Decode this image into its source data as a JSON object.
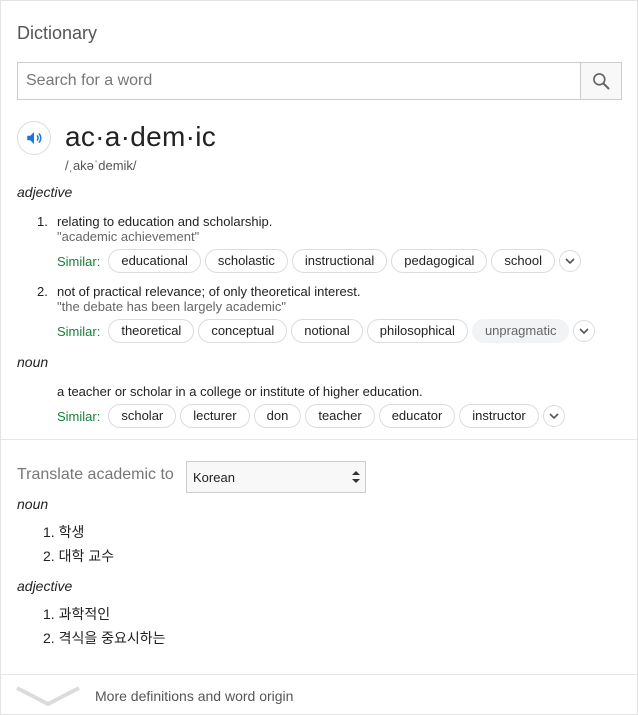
{
  "title": "Dictionary",
  "search": {
    "placeholder": "Search for a word",
    "value": ""
  },
  "entry": {
    "headword": "ac·a·dem·ic",
    "phonetic": "/ˌakəˈdemik/",
    "senses": [
      {
        "pos": "adjective",
        "definitions": [
          {
            "num": "1.",
            "text": "relating to education and scholarship.",
            "example": "\"academic achievement\"",
            "similar_label": "Similar:",
            "similar": [
              "educational",
              "scholastic",
              "instructional",
              "pedagogical",
              "school"
            ]
          },
          {
            "num": "2.",
            "text": "not of practical relevance; of only theoretical interest.",
            "example": "\"the debate has been largely academic\"",
            "similar_label": "Similar:",
            "similar": [
              "theoretical",
              "conceptual",
              "notional",
              "philosophical",
              "unpragmatic"
            ]
          }
        ]
      },
      {
        "pos": "noun",
        "definitions": [
          {
            "num": "",
            "text": "a teacher or scholar in a college or institute of higher education.",
            "similar_label": "Similar:",
            "similar": [
              "scholar",
              "lecturer",
              "don",
              "teacher",
              "educator",
              "instructor"
            ]
          }
        ]
      }
    ]
  },
  "translate": {
    "label": "Translate academic to",
    "language": "Korean",
    "groups": [
      {
        "pos": "noun",
        "items": [
          "1. 학생",
          "2. 대학 교수"
        ]
      },
      {
        "pos": "adjective",
        "items": [
          "1. 과학적인",
          "2. 격식을 중요시하는"
        ]
      }
    ]
  },
  "more_link": "More definitions and word origin",
  "colors": {
    "similar_label": "#188038",
    "audio_icon": "#1a73e8"
  },
  "icons": [
    "search-icon",
    "speaker-icon",
    "chevron-down-icon",
    "select-arrows-icon"
  ]
}
